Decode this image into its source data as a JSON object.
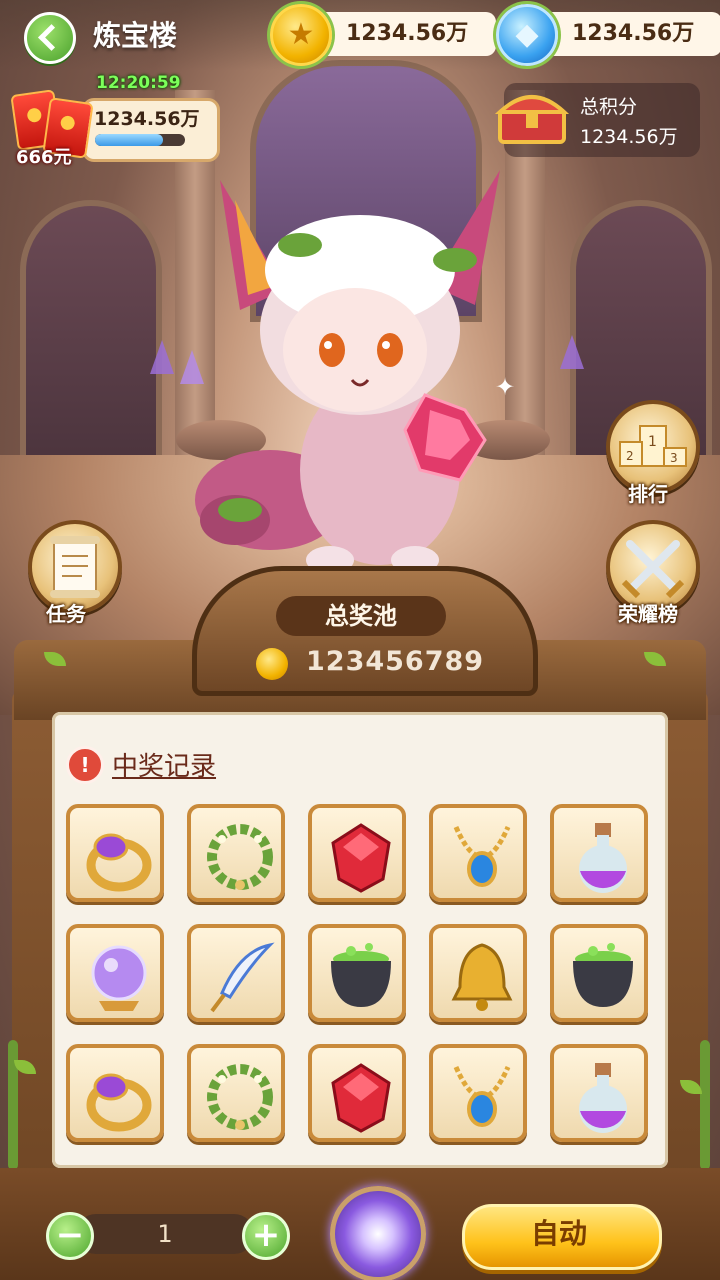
{
  "header": {
    "title": "炼宝楼",
    "coin_value": "1234.56万",
    "gem_value": "1234.56万"
  },
  "red_packet": {
    "timer": "12:20:59",
    "value": "1234.56万",
    "amount": "666元",
    "progress": 0.75
  },
  "score": {
    "label": "总积分",
    "value": "1234.56万"
  },
  "side_buttons": {
    "rank": "排行",
    "task": "任务",
    "honor": "荣耀榜"
  },
  "pool": {
    "label": "总奖池",
    "value": "123456789"
  },
  "records": {
    "label": "中奖记录"
  },
  "items": [
    [
      "purple-ring",
      "laurel-wreath",
      "red-gem",
      "sapphire-necklace",
      "purple-potion"
    ],
    [
      "crystal-ball",
      "quill-pen",
      "green-cauldron",
      "golden-bell",
      "green-cauldron"
    ],
    [
      "purple-ring",
      "laurel-wreath",
      "red-gem",
      "sapphire-necklace",
      "purple-potion"
    ]
  ],
  "controls": {
    "quantity": "1",
    "auto_label": "自动",
    "minus": "−",
    "plus": "+"
  },
  "colors": {
    "accent_green": "#4aa12c",
    "gold": "#ffc21a",
    "wood": "#6b4322"
  }
}
